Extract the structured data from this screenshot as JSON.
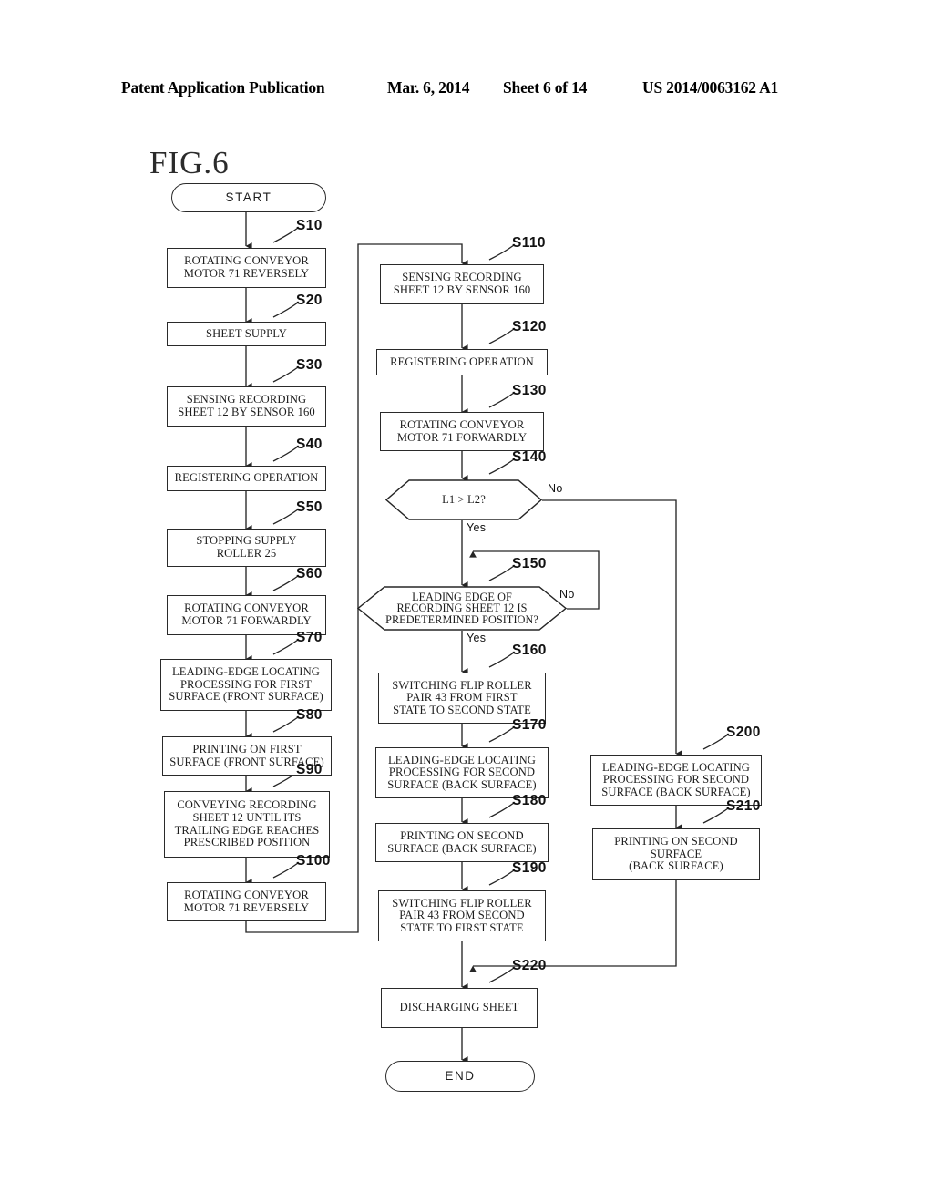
{
  "header": {
    "publication": "Patent Application Publication",
    "date": "Mar. 6, 2014",
    "sheet": "Sheet 6 of 14",
    "patent_number": "US 2014/0063162 A1"
  },
  "figure": {
    "label": "FIG.6"
  },
  "chart_data": {
    "type": "diagram",
    "title": "FIG.6",
    "diagram_kind": "flowchart",
    "nodes": [
      {
        "id": "start",
        "step": "",
        "shape": "terminator",
        "text": "START"
      },
      {
        "id": "s10",
        "step": "S10",
        "shape": "process",
        "text": "ROTATING CONVEYOR\nMOTOR 71 REVERSELY"
      },
      {
        "id": "s20",
        "step": "S20",
        "shape": "process",
        "text": "SHEET SUPPLY"
      },
      {
        "id": "s30",
        "step": "S30",
        "shape": "process",
        "text": "SENSING RECORDING\nSHEET 12 BY SENSOR 160"
      },
      {
        "id": "s40",
        "step": "S40",
        "shape": "process",
        "text": "REGISTERING OPERATION"
      },
      {
        "id": "s50",
        "step": "S50",
        "shape": "process",
        "text": "STOPPING SUPPLY\nROLLER 25"
      },
      {
        "id": "s60",
        "step": "S60",
        "shape": "process",
        "text": "ROTATING CONVEYOR\nMOTOR 71 FORWARDLY"
      },
      {
        "id": "s70",
        "step": "S70",
        "shape": "process",
        "text": "LEADING-EDGE LOCATING\nPROCESSING FOR FIRST\nSURFACE (FRONT SURFACE)"
      },
      {
        "id": "s80",
        "step": "S80",
        "shape": "process",
        "text": "PRINTING ON FIRST\nSURFACE (FRONT SURFACE)"
      },
      {
        "id": "s90",
        "step": "S90",
        "shape": "process",
        "text": "CONVEYING RECORDING\nSHEET 12 UNTIL ITS\nTRAILING EDGE REACHES\nPRESCRIBED POSITION"
      },
      {
        "id": "s100",
        "step": "S100",
        "shape": "process",
        "text": "ROTATING CONVEYOR\nMOTOR 71 REVERSELY"
      },
      {
        "id": "s110",
        "step": "S110",
        "shape": "process",
        "text": "SENSING RECORDING\nSHEET 12 BY SENSOR 160"
      },
      {
        "id": "s120",
        "step": "S120",
        "shape": "process",
        "text": "REGISTERING OPERATION"
      },
      {
        "id": "s130",
        "step": "S130",
        "shape": "process",
        "text": "ROTATING CONVEYOR\nMOTOR 71 FORWARDLY"
      },
      {
        "id": "s140",
        "step": "S140",
        "shape": "decision",
        "text": "L1 > L2?"
      },
      {
        "id": "s150",
        "step": "S150",
        "shape": "decision",
        "text": "LEADING EDGE OF\nRECORDING SHEET 12 IS\nPREDETERMINED POSITION?"
      },
      {
        "id": "s160",
        "step": "S160",
        "shape": "process",
        "text": "SWITCHING FLIP ROLLER\nPAIR 43 FROM FIRST\nSTATE TO SECOND STATE"
      },
      {
        "id": "s170",
        "step": "S170",
        "shape": "process",
        "text": "LEADING-EDGE LOCATING\nPROCESSING FOR SECOND\nSURFACE (BACK SURFACE)"
      },
      {
        "id": "s180",
        "step": "S180",
        "shape": "process",
        "text": "PRINTING ON SECOND\nSURFACE (BACK SURFACE)"
      },
      {
        "id": "s190",
        "step": "S190",
        "shape": "process",
        "text": "SWITCHING FLIP ROLLER\nPAIR 43 FROM SECOND\nSTATE TO FIRST STATE"
      },
      {
        "id": "s200",
        "step": "S200",
        "shape": "process",
        "text": "LEADING-EDGE LOCATING\nPROCESSING FOR SECOND\nSURFACE (BACK SURFACE)"
      },
      {
        "id": "s210",
        "step": "S210",
        "shape": "process",
        "text": "PRINTING ON SECOND\nSURFACE\n(BACK SURFACE)"
      },
      {
        "id": "s220",
        "step": "S220",
        "shape": "process",
        "text": "DISCHARGING SHEET"
      },
      {
        "id": "end",
        "step": "",
        "shape": "terminator",
        "text": "END"
      }
    ],
    "branch_labels": [
      {
        "id": "s140-no",
        "text": "No",
        "from": "s140"
      },
      {
        "id": "s140-yes",
        "text": "Yes",
        "from": "s140"
      },
      {
        "id": "s150-no",
        "text": "No",
        "from": "s150"
      },
      {
        "id": "s150-yes",
        "text": "Yes",
        "from": "s150"
      }
    ],
    "edges": [
      {
        "from": "start",
        "to": "s10"
      },
      {
        "from": "s10",
        "to": "s20"
      },
      {
        "from": "s20",
        "to": "s30"
      },
      {
        "from": "s30",
        "to": "s40"
      },
      {
        "from": "s40",
        "to": "s50"
      },
      {
        "from": "s50",
        "to": "s60"
      },
      {
        "from": "s60",
        "to": "s70"
      },
      {
        "from": "s70",
        "to": "s80"
      },
      {
        "from": "s80",
        "to": "s90"
      },
      {
        "from": "s90",
        "to": "s100"
      },
      {
        "from": "s100",
        "to": "s110"
      },
      {
        "from": "s110",
        "to": "s120"
      },
      {
        "from": "s120",
        "to": "s130"
      },
      {
        "from": "s130",
        "to": "s140"
      },
      {
        "from": "s140",
        "to": "s150",
        "label": "Yes"
      },
      {
        "from": "s140",
        "to": "s200",
        "label": "No"
      },
      {
        "from": "s150",
        "to": "s160",
        "label": "Yes"
      },
      {
        "from": "s150",
        "to": "s150",
        "label": "No"
      },
      {
        "from": "s160",
        "to": "s170"
      },
      {
        "from": "s170",
        "to": "s180"
      },
      {
        "from": "s180",
        "to": "s190"
      },
      {
        "from": "s190",
        "to": "s220"
      },
      {
        "from": "s200",
        "to": "s210"
      },
      {
        "from": "s210",
        "to": "s220"
      },
      {
        "from": "s220",
        "to": "end"
      }
    ]
  }
}
